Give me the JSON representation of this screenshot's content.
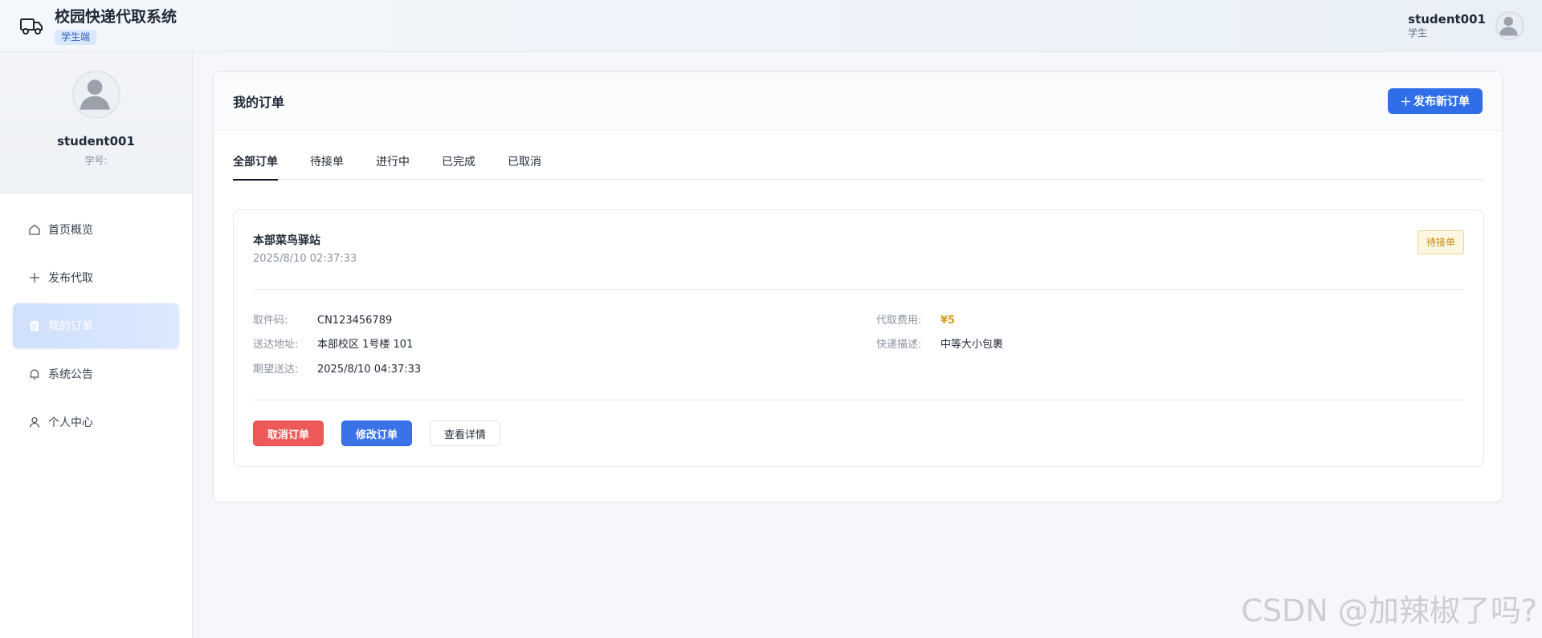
{
  "header": {
    "title": "校园快递代取系统",
    "badge": "学生端",
    "user_name": "student001",
    "user_role": "学生"
  },
  "profile": {
    "name": "student001",
    "id_label": "学号:"
  },
  "sidebar": {
    "items": [
      {
        "label": "首页概览",
        "icon": "home-icon"
      },
      {
        "label": "发布代取",
        "icon": "plus-icon"
      },
      {
        "label": "我的订单",
        "icon": "clipboard-icon",
        "active": true
      },
      {
        "label": "系统公告",
        "icon": "bell-icon"
      },
      {
        "label": "个人中心",
        "icon": "user-icon"
      }
    ]
  },
  "main": {
    "title": "我的订单",
    "publish_label": "发布新订单",
    "tabs": [
      {
        "label": "全部订单",
        "active": true
      },
      {
        "label": "待接单"
      },
      {
        "label": "进行中"
      },
      {
        "label": "已完成"
      },
      {
        "label": "已取消"
      }
    ]
  },
  "order": {
    "station": "本部菜鸟驿站",
    "created_at": "2025/8/10 02:37:33",
    "status": "待接单",
    "pickup_code_label": "取件码:",
    "pickup_code": "CN123456789",
    "address_label": "送达地址:",
    "address": "本部校区 1号楼 101",
    "expected_label": "期望送达:",
    "expected": "2025/8/10 04:37:33",
    "fee_label": "代取费用:",
    "fee": "¥5",
    "desc_label": "快递描述:",
    "desc": "中等大小包裹",
    "actions": {
      "cancel": "取消订单",
      "edit": "修改订单",
      "detail": "查看详情"
    }
  },
  "watermark": "CSDN @加辣椒了吗?",
  "colors": {
    "primary": "#2f6ee8",
    "danger": "#ee5a5a",
    "warning": "#d49b1a"
  }
}
